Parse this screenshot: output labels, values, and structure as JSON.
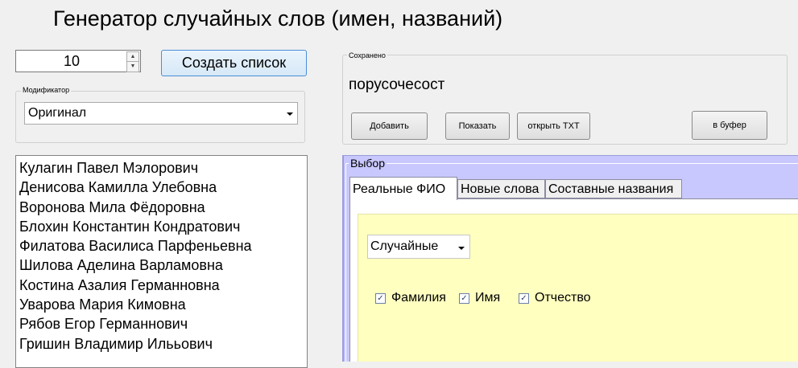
{
  "app": {
    "title": "Генератор случайных слов (имен, названий)"
  },
  "count": {
    "value": "10"
  },
  "create_button": {
    "label": "Создать список"
  },
  "modifier": {
    "label": "Модификатор",
    "selected": "Оригинал"
  },
  "names": [
    "Кулагин Павел Мэлорович",
    "Денисова Камилла Улебовна",
    "Воронова Мила Фёдоровна",
    "Блохин Константин Кондратович",
    "Филатова Василиса Парфеньевна",
    "Шилова Аделина Варламовна",
    "Костина Азалия Германновна",
    "Уварова Мария Кимовна",
    "Рябов Егор Германнович",
    "Гришин Владимир Илььович"
  ],
  "saved": {
    "label": "Сохранено",
    "word": "порусочесост",
    "buttons": {
      "add": "Добавить",
      "show": "Показать",
      "open_txt": "открыть TXT",
      "to_buffer": "в буфер"
    }
  },
  "choice": {
    "label": "Выбор",
    "tabs": [
      {
        "label": "Реальные ФИО",
        "active": true
      },
      {
        "label": "Новые слова",
        "active": false
      },
      {
        "label": "Составные названия",
        "active": false
      }
    ],
    "mode_select": "Случайные",
    "checkboxes": [
      {
        "label": "Фамилия",
        "checked": true
      },
      {
        "label": "Имя",
        "checked": true
      },
      {
        "label": "Отчество",
        "checked": true
      }
    ]
  },
  "colors": {
    "choice_panel": "#c8c8ff",
    "tab_content": "#ffffc0",
    "accent_border": "#4a8fd6"
  }
}
